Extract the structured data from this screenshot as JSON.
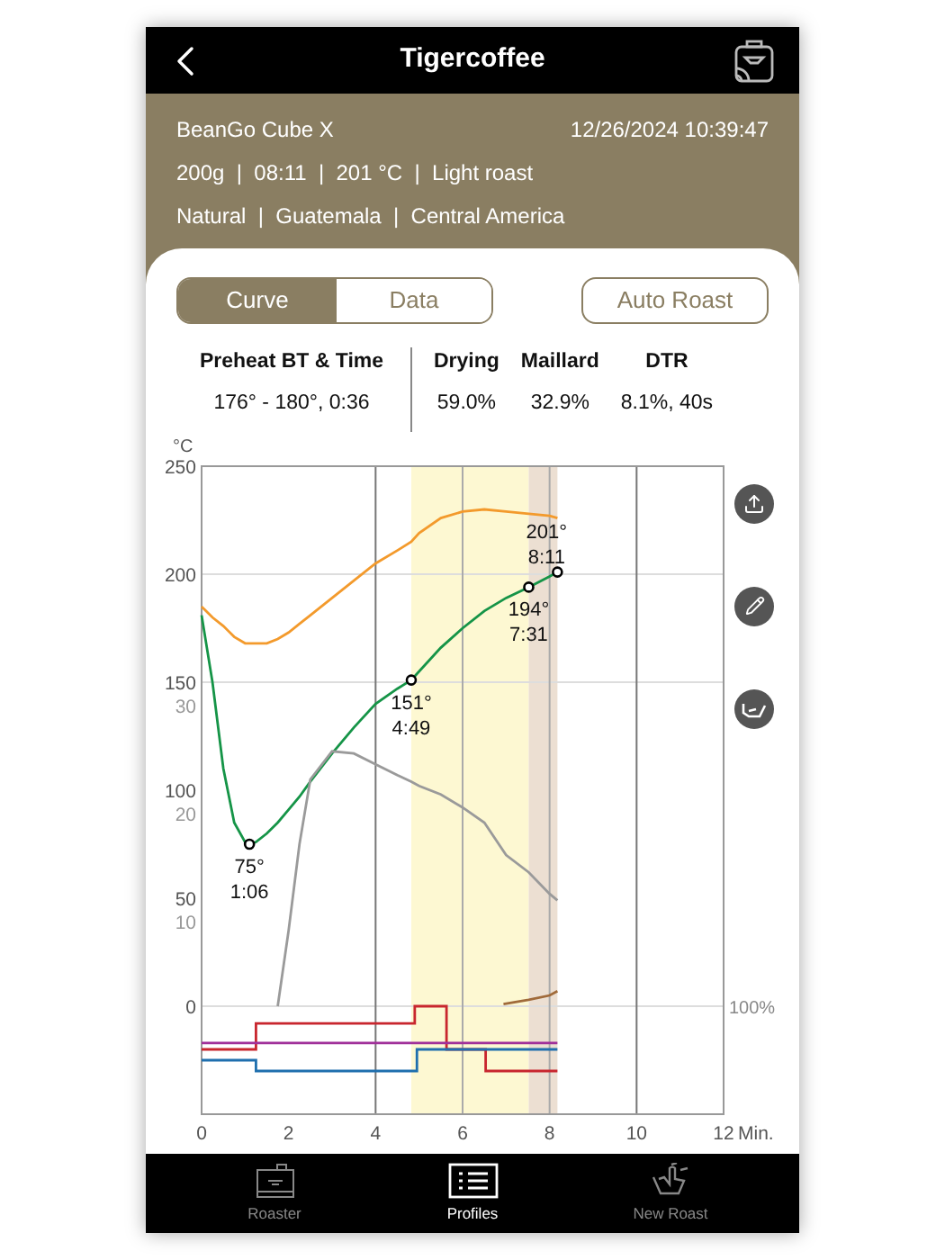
{
  "header": {
    "title": "Tigercoffee"
  },
  "info": {
    "device": "BeanGo Cube X",
    "datetime": "12/26/2024 10:39:47",
    "details": "200g  |  08:11  |  201 °C  |  Light roast",
    "origin": "Natural  |  Guatemala  |  Central America"
  },
  "tabs": [
    {
      "label": "Curve",
      "selected": true
    },
    {
      "label": "Data",
      "selected": false
    }
  ],
  "auto_roast_button": "Auto Roast",
  "stats": [
    {
      "label": "Preheat BT & Time",
      "value": "176° - 180°, 0:36"
    },
    {
      "label": "Drying",
      "value": "59.0%"
    },
    {
      "label": "Maillard",
      "value": "32.9%"
    },
    {
      "label": "DTR",
      "value": "8.1%, 40s"
    }
  ],
  "chart": {
    "ror_ticks": [
      "30",
      "20",
      "10"
    ],
    "percent_label": "100%",
    "chart_data": {
      "type": "line",
      "xlabel": "Min.",
      "ylabel": "°C",
      "xlim": [
        0,
        12
      ],
      "ylim": [
        -50,
        250
      ],
      "xticks": [
        0,
        2,
        4,
        6,
        8,
        10,
        12
      ],
      "yticks": [
        0,
        50,
        100,
        150,
        200,
        250
      ],
      "grid": true,
      "x": [
        0,
        0.25,
        0.5,
        0.75,
        1,
        1.1,
        1.25,
        1.5,
        1.75,
        2,
        2.25,
        2.5,
        3,
        3.5,
        4,
        4.5,
        4.82,
        5,
        5.5,
        6,
        6.5,
        7,
        7.52,
        8,
        8.18
      ],
      "series": [
        {
          "color": "#f39a2c",
          "values": [
            185,
            180,
            176,
            171,
            168,
            168,
            168,
            168,
            170,
            173,
            177,
            181,
            189,
            197,
            205,
            211,
            215,
            219,
            226,
            229,
            230,
            229,
            228,
            227,
            226
          ]
        },
        {
          "color": "#159447",
          "values": [
            181,
            150,
            110,
            85,
            76,
            75,
            76,
            80,
            85,
            91,
            97,
            104,
            117,
            129,
            140,
            147,
            151,
            155,
            166,
            175,
            183,
            189,
            194,
            199,
            201
          ]
        },
        {
          "color": "#9a9a9a",
          "values": [
            null,
            null,
            null,
            null,
            null,
            null,
            null,
            null,
            0,
            35,
            75,
            105,
            118,
            117,
            112,
            107,
            104,
            102,
            98,
            92,
            85,
            70,
            62,
            52,
            49
          ]
        },
        {
          "color": "#c8262e",
          "x": [
            0,
            1.25,
            1.25,
            4.9,
            4.9,
            5.63,
            5.63,
            6.53,
            6.53,
            8.18
          ],
          "values": [
            -20,
            -20,
            -8,
            -8,
            0,
            0,
            -20,
            -20,
            -30,
            -30
          ]
        },
        {
          "color": "#1f6fae",
          "x": [
            0,
            1.25,
            1.25,
            4.95,
            4.95,
            8.18
          ],
          "values": [
            -25,
            -25,
            -30,
            -30,
            -20,
            -20
          ]
        },
        {
          "color": "#a0309a",
          "x": [
            0,
            8.18
          ],
          "values": [
            -17,
            -17
          ]
        },
        {
          "color": "#a06a3a",
          "x": [
            6.94,
            7.52,
            8,
            8.18
          ],
          "values": [
            1,
            3,
            5,
            7
          ]
        }
      ],
      "ref_lines": [
        {
          "axis": "x",
          "value": 6
        },
        {
          "axis": "x",
          "value": 8
        }
      ],
      "bands": [
        {
          "axis": "x",
          "from": 4.82,
          "to": 7.52,
          "color": "#fdf8d2"
        },
        {
          "axis": "x",
          "from": 7.52,
          "to": 8.18,
          "color": "#ecdfd2"
        }
      ],
      "annotations": [
        {
          "x": 1.1,
          "y": 75,
          "text": "75°"
        },
        {
          "x": 1.1,
          "y": 75,
          "text": "1:06"
        },
        {
          "x": 4.82,
          "y": 151,
          "text": "151°"
        },
        {
          "x": 4.82,
          "y": 151,
          "text": "4:49"
        },
        {
          "x": 7.52,
          "y": 194,
          "text": "194°"
        },
        {
          "x": 7.52,
          "y": 194,
          "text": "7:31"
        },
        {
          "x": 8.18,
          "y": 201,
          "text": "201°"
        },
        {
          "x": 8.18,
          "y": 201,
          "text": "8:11"
        }
      ]
    }
  },
  "nav": [
    {
      "label": "Roaster",
      "kind": "roaster",
      "selected": false
    },
    {
      "label": "Profiles",
      "kind": "profiles",
      "selected": true
    },
    {
      "label": "New Roast",
      "kind": "hand",
      "selected": false
    }
  ]
}
